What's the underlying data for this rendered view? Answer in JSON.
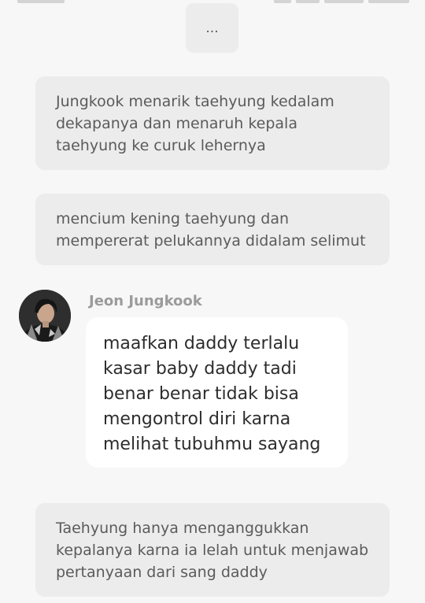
{
  "colors": {
    "background": "#f7f7f7",
    "narration_bubble": "#ececec",
    "chat_bubble": "#ffffff",
    "narration_text": "#5b5b5b",
    "chat_text": "#2d2d2d",
    "sender_name": "#9b9b9b"
  },
  "thread": {
    "ellipsis": "...",
    "narration_1": "Jungkook menarik taehyung kedalam dekapanya dan menaruh kepala taehyung ke curuk lehernya",
    "narration_2": "mencium kening taehyung dan mempererat pelukannya didalam selimut",
    "message": {
      "sender": "Jeon Jungkook",
      "avatar_icon": "profile-photo",
      "text": "maafkan daddy terlalu kasar baby daddy tadi benar benar tidak bisa mengontrol diri karna melihat tubuhmu sayang"
    },
    "narration_3": "Taehyung hanya menganggukkan kepalanya karna ia lelah untuk menjawab pertanyaan dari sang daddy"
  }
}
